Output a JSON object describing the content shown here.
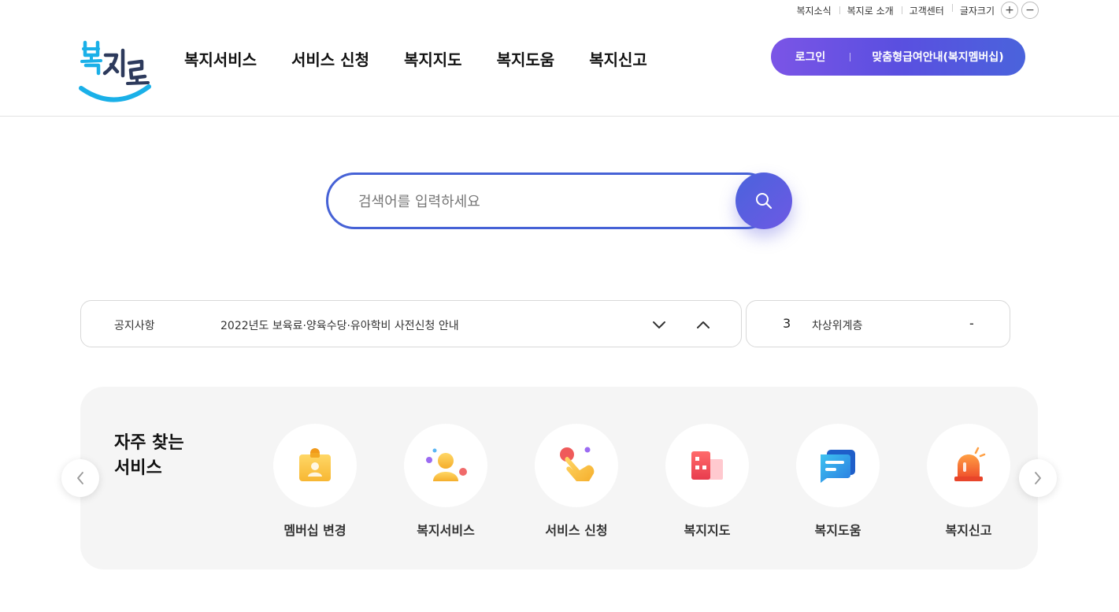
{
  "util_nav": {
    "links": [
      "복지소식",
      "복지로 소개",
      "고객센터"
    ],
    "font_size_label": "글자크기",
    "font_increase": "+",
    "font_decrease": "−"
  },
  "header": {
    "logo_text": "복지로",
    "gnb": [
      "복지서비스",
      "서비스 신청",
      "복지지도",
      "복지도움",
      "복지신고"
    ],
    "login_label": "로그인",
    "member_label": "맞춤형급여안내(복지멤버십)"
  },
  "search": {
    "placeholder": "검색어를 입력하세요",
    "value": ""
  },
  "notice": {
    "label": "공지사항",
    "text": "2022년도 보육료·양육수당·유아학비 사전신청 안내"
  },
  "ranking": {
    "number": "3",
    "keyword": "차상위계층",
    "change": "-"
  },
  "frequent": {
    "title": "자주 찾는\n서비스",
    "items": [
      {
        "label": "멤버십 변경",
        "icon": "membership-card-icon"
      },
      {
        "label": "복지서비스",
        "icon": "person-icon"
      },
      {
        "label": "서비스 신청",
        "icon": "hand-pointer-icon"
      },
      {
        "label": "복지지도",
        "icon": "building-map-icon"
      },
      {
        "label": "복지도움",
        "icon": "chat-bubble-icon"
      },
      {
        "label": "복지신고",
        "icon": "alarm-siren-icon"
      }
    ]
  },
  "colors": {
    "accent_blue": "#4662d6",
    "accent_purple": "#7b55e6",
    "logo_blue": "#1ab0e8"
  }
}
